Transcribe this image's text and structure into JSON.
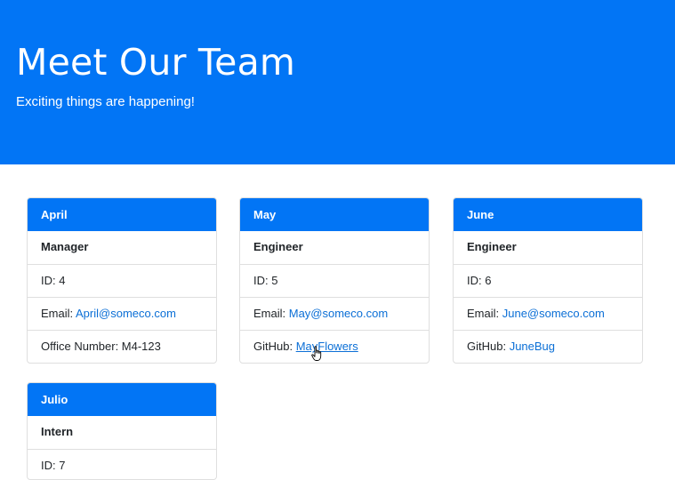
{
  "header": {
    "title": "Meet Our Team",
    "subtitle": "Exciting things are happening!"
  },
  "cards": [
    {
      "name": "April",
      "role": "Manager",
      "id": "ID: 4",
      "email_label": "Email: ",
      "email": "April@someco.com",
      "extra_label": "Office Number: M4-123",
      "extra_link": ""
    },
    {
      "name": "May",
      "role": "Engineer",
      "id": "ID: 5",
      "email_label": "Email: ",
      "email": "May@someco.com",
      "extra_label": "GitHub: ",
      "extra_link": "MayFlowers"
    },
    {
      "name": "June",
      "role": "Engineer",
      "id": "ID: 6",
      "email_label": "Email: ",
      "email": "June@someco.com",
      "extra_label": "GitHub: ",
      "extra_link": "JuneBug"
    },
    {
      "name": "Julio",
      "role": "Intern",
      "id": "ID: 7"
    }
  ],
  "colors": {
    "primary": "#0275f5",
    "link": "#0b6fd6",
    "border": "#dfdfdf"
  }
}
